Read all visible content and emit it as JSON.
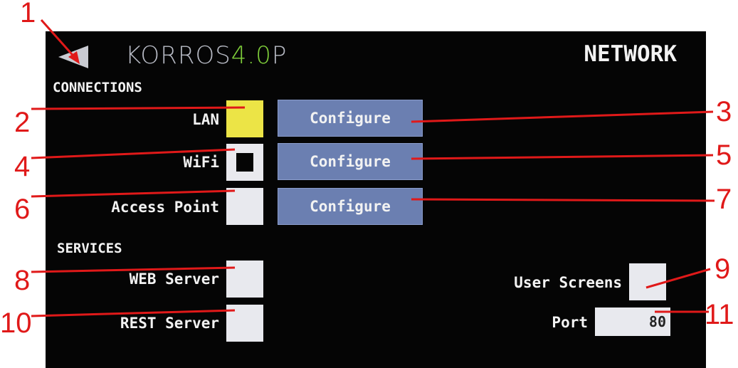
{
  "header": {
    "logo_main": "KORROS",
    "logo_accent": "4.0",
    "logo_end": "P",
    "title": "NETWORK"
  },
  "sections": {
    "connections": "CONNECTIONS",
    "services": "SERVICES"
  },
  "connections": [
    {
      "label": "LAN",
      "checked": true,
      "configure_label": "Configure"
    },
    {
      "label": "WiFi",
      "checked": false,
      "configure_label": "Configure"
    },
    {
      "label": "Access Point",
      "checked": false,
      "configure_label": "Configure"
    }
  ],
  "services": {
    "web_server": {
      "label": "WEB Server",
      "checked": false
    },
    "rest_server": {
      "label": "REST Server",
      "checked": false
    },
    "user_screens": {
      "label": "User Screens",
      "checked": false
    },
    "port": {
      "label": "Port",
      "value": "80"
    }
  },
  "callouts": [
    "1",
    "2",
    "3",
    "4",
    "5",
    "6",
    "7",
    "8",
    "9",
    "10",
    "11"
  ],
  "colors": {
    "screen_bg": "#050505",
    "checked_yellow": "#ece446",
    "button_blue": "#6b7fb1",
    "callout_red": "#e01919",
    "logo_accent_green": "#7fcf3a"
  }
}
